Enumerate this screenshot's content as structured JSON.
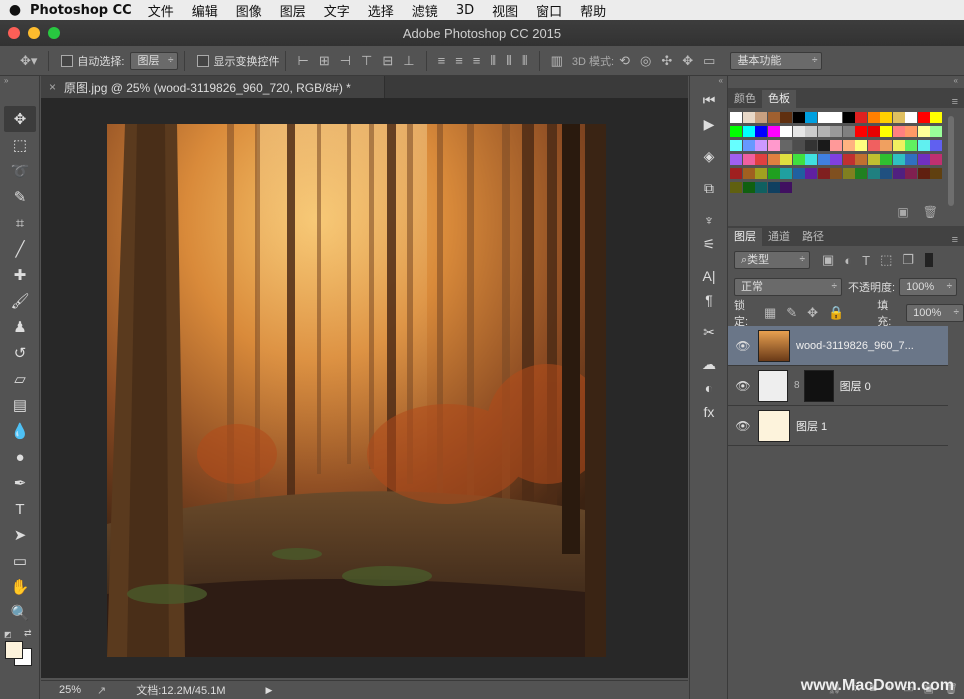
{
  "menubar": {
    "apple": "",
    "app": "Photoshop CC",
    "items": [
      "文件",
      "编辑",
      "图像",
      "图层",
      "文字",
      "选择",
      "滤镜",
      "3D",
      "视图",
      "窗口",
      "帮助"
    ]
  },
  "window": {
    "title": "Adobe Photoshop CC 2015"
  },
  "options": {
    "auto_select_label": "自动选择:",
    "auto_select_value": "图层",
    "show_transform_label": "显示变换控件",
    "mode3d_label": "3D 模式:",
    "workspace": "基本功能"
  },
  "document": {
    "tab_title": "原图.jpg @ 25% (wood-3119826_960_720, RGB/8#) *",
    "close_glyph": "×"
  },
  "status": {
    "zoom": "25%",
    "doc_info": "文档:12.2M/45.1M"
  },
  "swatches_panel": {
    "tabs": [
      "颜色",
      "色板"
    ],
    "colors": [
      "#ffffff",
      "#e8d8c8",
      "#c8a080",
      "#a06030",
      "#603010",
      "#000000",
      "#00a0e0",
      "#ffffff",
      "#ffffff",
      "#000000",
      "#e02020",
      "#ff7f00",
      "#ffd000",
      "#e0c060",
      "#ffffff",
      "#ff0000",
      "#ffff00",
      "#00ff00",
      "#00ffff",
      "#0000ff",
      "#ff00ff",
      "#ffffff",
      "#e6e6e6",
      "#cccccc",
      "#b3b3b3",
      "#999999",
      "#808080",
      "#ff0000",
      "#e60000",
      "#ffff00",
      "#ff8080",
      "#ff9966",
      "#ffff99",
      "#99ff99",
      "#66ffff",
      "#6699ff",
      "#cc99ff",
      "#ff99cc",
      "#666666",
      "#4d4d4d",
      "#333333",
      "#1a1a1a",
      "#ff9999",
      "#ffb380",
      "#ffff80",
      "#f06060",
      "#f0a060",
      "#f0f060",
      "#60f060",
      "#60f0f0",
      "#6060f0",
      "#a060f0",
      "#f060a0",
      "#e04040",
      "#e08040",
      "#e0e040",
      "#40e040",
      "#40e0e0",
      "#4080e0",
      "#8040e0",
      "#c03030",
      "#c07030",
      "#c0c030",
      "#30c030",
      "#30c0c0",
      "#3070c0",
      "#7030c0",
      "#c03070",
      "#a02020",
      "#a06020",
      "#a0a020",
      "#20a020",
      "#20a0a0",
      "#2060a0",
      "#6020a0",
      "#802020",
      "#805020",
      "#808020",
      "#208020",
      "#208080",
      "#205080",
      "#502080",
      "#802050",
      "#602010",
      "#604010",
      "#606010",
      "#106010",
      "#106060",
      "#104060",
      "#401060"
    ]
  },
  "layers_panel": {
    "tabs": [
      "图层",
      "通道",
      "路径"
    ],
    "filter_kind": "类型",
    "blend_mode": "正常",
    "opacity_label": "不透明度:",
    "opacity_value": "100%",
    "lock_label": "锁定:",
    "fill_label": "填充:",
    "fill_value": "100%",
    "layers": [
      {
        "name": "wood-3119826_960_7...",
        "selected": true
      },
      {
        "name": "图层 0",
        "selected": false
      },
      {
        "name": "图层 1",
        "selected": false
      }
    ]
  },
  "watermark": "www.MacDown.com"
}
